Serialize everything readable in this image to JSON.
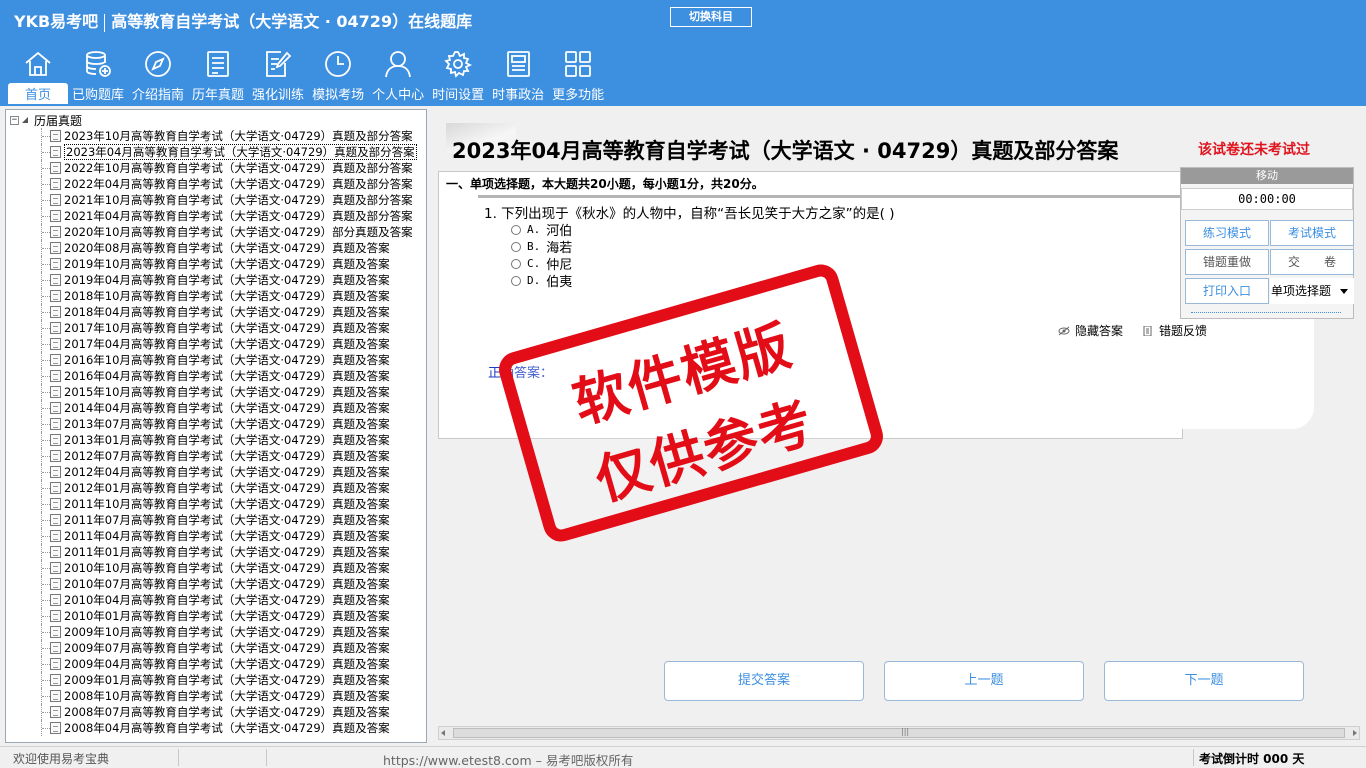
{
  "header": {
    "brand_logo": "YKB易考吧",
    "app_title": "高等教育自学考试（大学语文 · 04729）在线题库",
    "switch_subject": "切换科目",
    "nav": [
      {
        "label": "首页",
        "icon": "home-icon"
      },
      {
        "label": "已购题库",
        "icon": "database-icon"
      },
      {
        "label": "介绍指南",
        "icon": "compass-icon"
      },
      {
        "label": "历年真题",
        "icon": "list-doc-icon"
      },
      {
        "label": "强化训练",
        "icon": "edit-doc-icon"
      },
      {
        "label": "模拟考场",
        "icon": "clock-icon"
      },
      {
        "label": "个人中心",
        "icon": "user-icon"
      },
      {
        "label": "时间设置",
        "icon": "gear-icon"
      },
      {
        "label": "时事政治",
        "icon": "news-icon"
      },
      {
        "label": "更多功能",
        "icon": "grid-icon"
      }
    ],
    "active_nav": "首页"
  },
  "tree": {
    "root": "历届真题",
    "items": [
      "2023年10月高等教育自学考试（大学语文·04729）真题及部分答案",
      "2023年04月高等教育自学考试（大学语文·04729）真题及部分答案",
      "2022年10月高等教育自学考试（大学语文·04729）真题及部分答案",
      "2022年04月高等教育自学考试（大学语文·04729）真题及部分答案",
      "2021年10月高等教育自学考试（大学语文·04729）真题及部分答案",
      "2021年04月高等教育自学考试（大学语文·04729）真题及部分答案",
      "2020年10月高等教育自学考试（大学语文·04729）部分真题及答案",
      "2020年08月高等教育自学考试（大学语文·04729）真题及答案",
      "2019年10月高等教育自学考试（大学语文·04729）真题及答案",
      "2019年04月高等教育自学考试（大学语文·04729）真题及答案",
      "2018年10月高等教育自学考试（大学语文·04729）真题及答案",
      "2018年04月高等教育自学考试（大学语文·04729）真题及答案",
      "2017年10月高等教育自学考试（大学语文·04729）真题及答案",
      "2017年04月高等教育自学考试（大学语文·04729）真题及答案",
      "2016年10月高等教育自学考试（大学语文·04729）真题及答案",
      "2016年04月高等教育自学考试（大学语文·04729）真题及答案",
      "2015年10月高等教育自学考试（大学语文·04729）真题及答案",
      "2014年04月高等教育自学考试（大学语文·04729）真题及答案",
      "2013年07月高等教育自学考试（大学语文·04729）真题及答案",
      "2013年01月高等教育自学考试（大学语文·04729）真题及答案",
      "2012年07月高等教育自学考试（大学语文·04729）真题及答案",
      "2012年04月高等教育自学考试（大学语文·04729）真题及答案",
      "2012年01月高等教育自学考试（大学语文·04729）真题及答案",
      "2011年10月高等教育自学考试（大学语文·04729）真题及答案",
      "2011年07月高等教育自学考试（大学语文·04729）真题及答案",
      "2011年04月高等教育自学考试（大学语文·04729）真题及答案",
      "2011年01月高等教育自学考试（大学语文·04729）真题及答案",
      "2010年10月高等教育自学考试（大学语文·04729）真题及答案",
      "2010年07月高等教育自学考试（大学语文·04729）真题及答案",
      "2010年04月高等教育自学考试（大学语文·04729）真题及答案",
      "2010年01月高等教育自学考试（大学语文·04729）真题及答案",
      "2009年10月高等教育自学考试（大学语文·04729）真题及答案",
      "2009年07月高等教育自学考试（大学语文·04729）真题及答案",
      "2009年04月高等教育自学考试（大学语文·04729）真题及答案",
      "2009年01月高等教育自学考试（大学语文·04729）真题及答案",
      "2008年10月高等教育自学考试（大学语文·04729）真题及答案",
      "2008年07月高等教育自学考试（大学语文·04729）真题及答案",
      "2008年04月高等教育自学考试（大学语文·04729）真题及答案"
    ],
    "selected_index": 1
  },
  "exam": {
    "title": "2023年04月高等教育自学考试（大学语文 · 04729）真题及部分答案",
    "status": "该试卷还未考试过",
    "section_header": "一、单项选择题，本大题共20小题，每小题1分，共20分。",
    "question": "1. 下列出现于《秋水》的人物中，自称“吾长见笑于大方之家”的是( )",
    "options": [
      {
        "letter": "A.",
        "text": "河伯"
      },
      {
        "letter": "B.",
        "text": "海若"
      },
      {
        "letter": "C.",
        "text": "仲尼"
      },
      {
        "letter": "D.",
        "text": "伯夷"
      }
    ],
    "hide_answer": "隐藏答案",
    "error_feedback": "错题反馈",
    "correct_answer_label": "正确答案："
  },
  "tools": {
    "move": "移动",
    "timer": "00:00:00",
    "practice_mode": "练习模式",
    "exam_mode": "考试模式",
    "redo_wrong": "错题重做",
    "submit_paper": "交　　卷",
    "print_entry": "打印入口",
    "question_type": "单项选择题"
  },
  "buttons": {
    "submit": "提交答案",
    "prev": "上一题",
    "next": "下一题"
  },
  "stamp": {
    "line1": "软件模版",
    "line2": "仅供参考"
  },
  "status": {
    "welcome": "欢迎使用易考宝典",
    "copyright": "https://www.etest8.com – 易考吧版权所有",
    "countdown": "考试倒计时 000 天"
  },
  "colors": {
    "header_bg": "#3d8fe0",
    "stamp_red": "#e30d17",
    "status_red": "#e0141e",
    "answer_blue": "#1a3cc8"
  }
}
